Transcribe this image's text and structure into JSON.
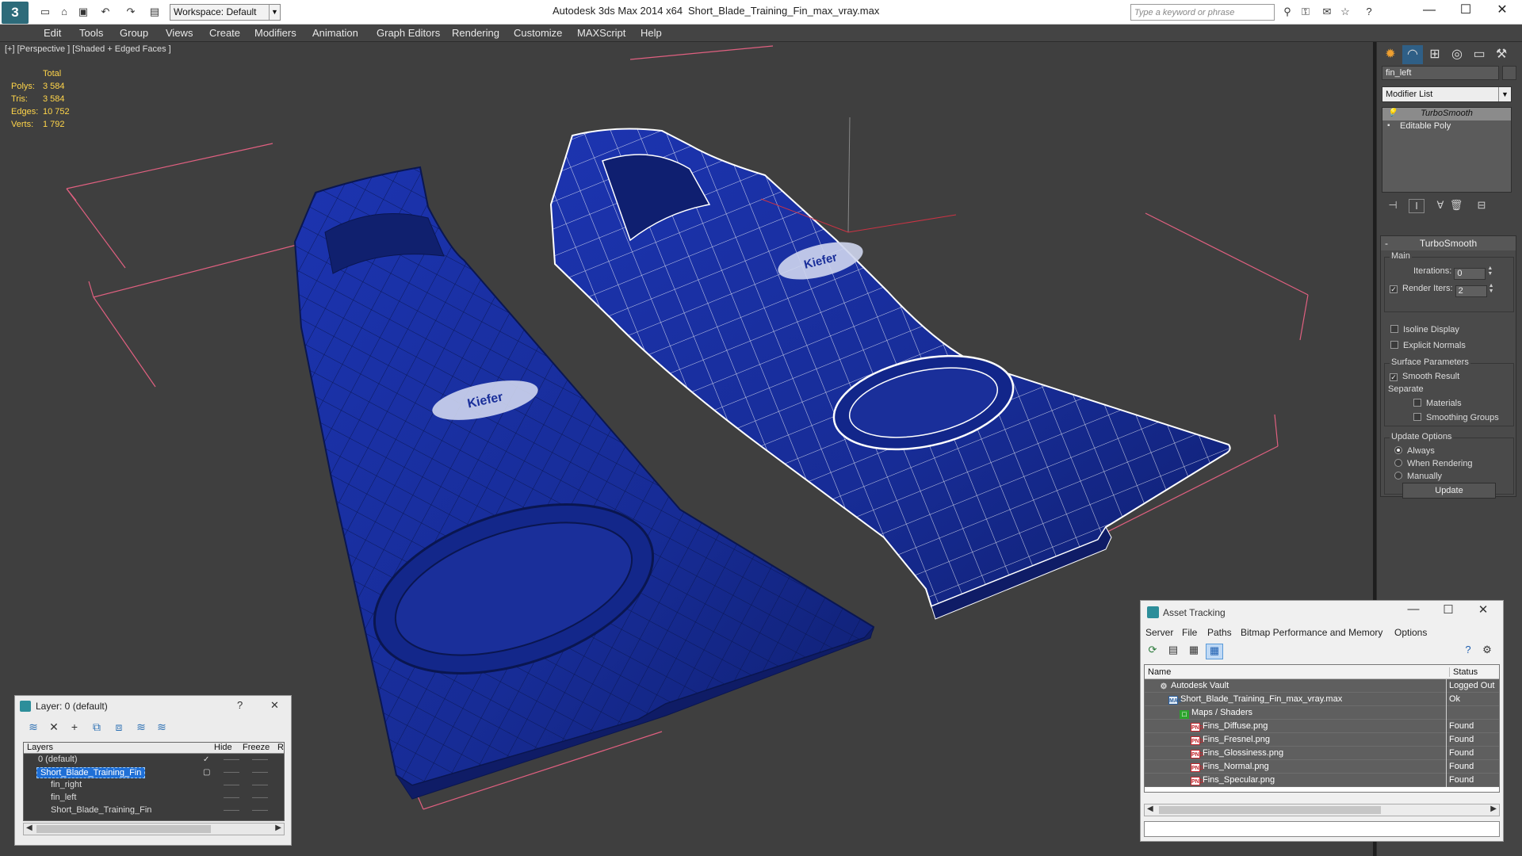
{
  "titlebar": {
    "app_title": "Autodesk 3ds Max  2014 x64",
    "file_title": "Short_Blade_Training_Fin_max_vray.max",
    "workspace_label": "Workspace: Default",
    "search_placeholder": "Type a keyword or phrase"
  },
  "menu": [
    "Edit",
    "Tools",
    "Group",
    "Views",
    "Create",
    "Modifiers",
    "Animation",
    "Graph Editors",
    "Rendering",
    "Customize",
    "MAXScript",
    "Help"
  ],
  "viewport": {
    "label": "[+] [Perspective ] [Shaded + Edged Faces ]",
    "stats": {
      "header": "Total",
      "polys_label": "Polys:",
      "polys": "3 584",
      "tris_label": "Tris:",
      "tris": "3 584",
      "edges_label": "Edges:",
      "edges": "10 752",
      "verts_label": "Verts:",
      "verts": "1 792"
    },
    "logo_text_left": "Kiefer",
    "logo_text_right": "Kiefer",
    "colors": {
      "fin": "#1a2f9a",
      "bg": "#3f3f3f",
      "bbox": "#e06080",
      "wire": "#ffffff"
    }
  },
  "command_panel": {
    "object_name": "fin_left",
    "modifier_list": "Modifier List",
    "stack": [
      "TurboSmooth",
      "Editable Poly"
    ],
    "turbosmooth": {
      "title": "TurboSmooth",
      "main_label": "Main",
      "iterations_label": "Iterations:",
      "iterations_value": "0",
      "render_iters_label": "Render Iters:",
      "render_iters_value": "2",
      "isoline_label": "Isoline Display",
      "explicit_normals_label": "Explicit Normals",
      "surface_params_label": "Surface Parameters",
      "smooth_result_label": "Smooth Result",
      "separate_label": "Separate",
      "materials_label": "Materials",
      "smoothing_groups_label": "Smoothing Groups",
      "update_options_label": "Update Options",
      "always_label": "Always",
      "when_rendering_label": "When Rendering",
      "manually_label": "Manually",
      "update_button": "Update"
    }
  },
  "layer_window": {
    "title": "Layer: 0 (default)",
    "help": "?",
    "close": "✕",
    "columns": [
      "Layers",
      "Hide",
      "Freeze",
      "R"
    ],
    "rows": [
      {
        "name": "0 (default)",
        "indent": 0
      },
      {
        "name": "Short_Blade_Training_Fin",
        "indent": 0
      },
      {
        "name": "fin_right",
        "indent": 1
      },
      {
        "name": "fin_left",
        "indent": 1
      },
      {
        "name": "Short_Blade_Training_Fin",
        "indent": 1
      }
    ]
  },
  "asset_window": {
    "title": "Asset Tracking",
    "menu": [
      "Server",
      "File",
      "Paths",
      "Bitmap Performance and Memory",
      "Options"
    ],
    "columns": [
      "Name",
      "Status"
    ],
    "rows": [
      {
        "name": "Autodesk Vault",
        "status": "Logged Out",
        "icon": "vault",
        "indent": 0
      },
      {
        "name": "Short_Blade_Training_Fin_max_vray.max",
        "status": "Ok",
        "icon": "max",
        "indent": 1
      },
      {
        "name": "Maps / Shaders",
        "status": "",
        "icon": "maps",
        "indent": 2
      },
      {
        "name": "Fins_Diffuse.png",
        "status": "Found",
        "icon": "png",
        "indent": 3
      },
      {
        "name": "Fins_Fresnel.png",
        "status": "Found",
        "icon": "png",
        "indent": 3
      },
      {
        "name": "Fins_Glossiness.png",
        "status": "Found",
        "icon": "png",
        "indent": 3
      },
      {
        "name": "Fins_Normal.png",
        "status": "Found",
        "icon": "png",
        "indent": 3
      },
      {
        "name": "Fins_Specular.png",
        "status": "Found",
        "icon": "png",
        "indent": 3
      }
    ]
  }
}
